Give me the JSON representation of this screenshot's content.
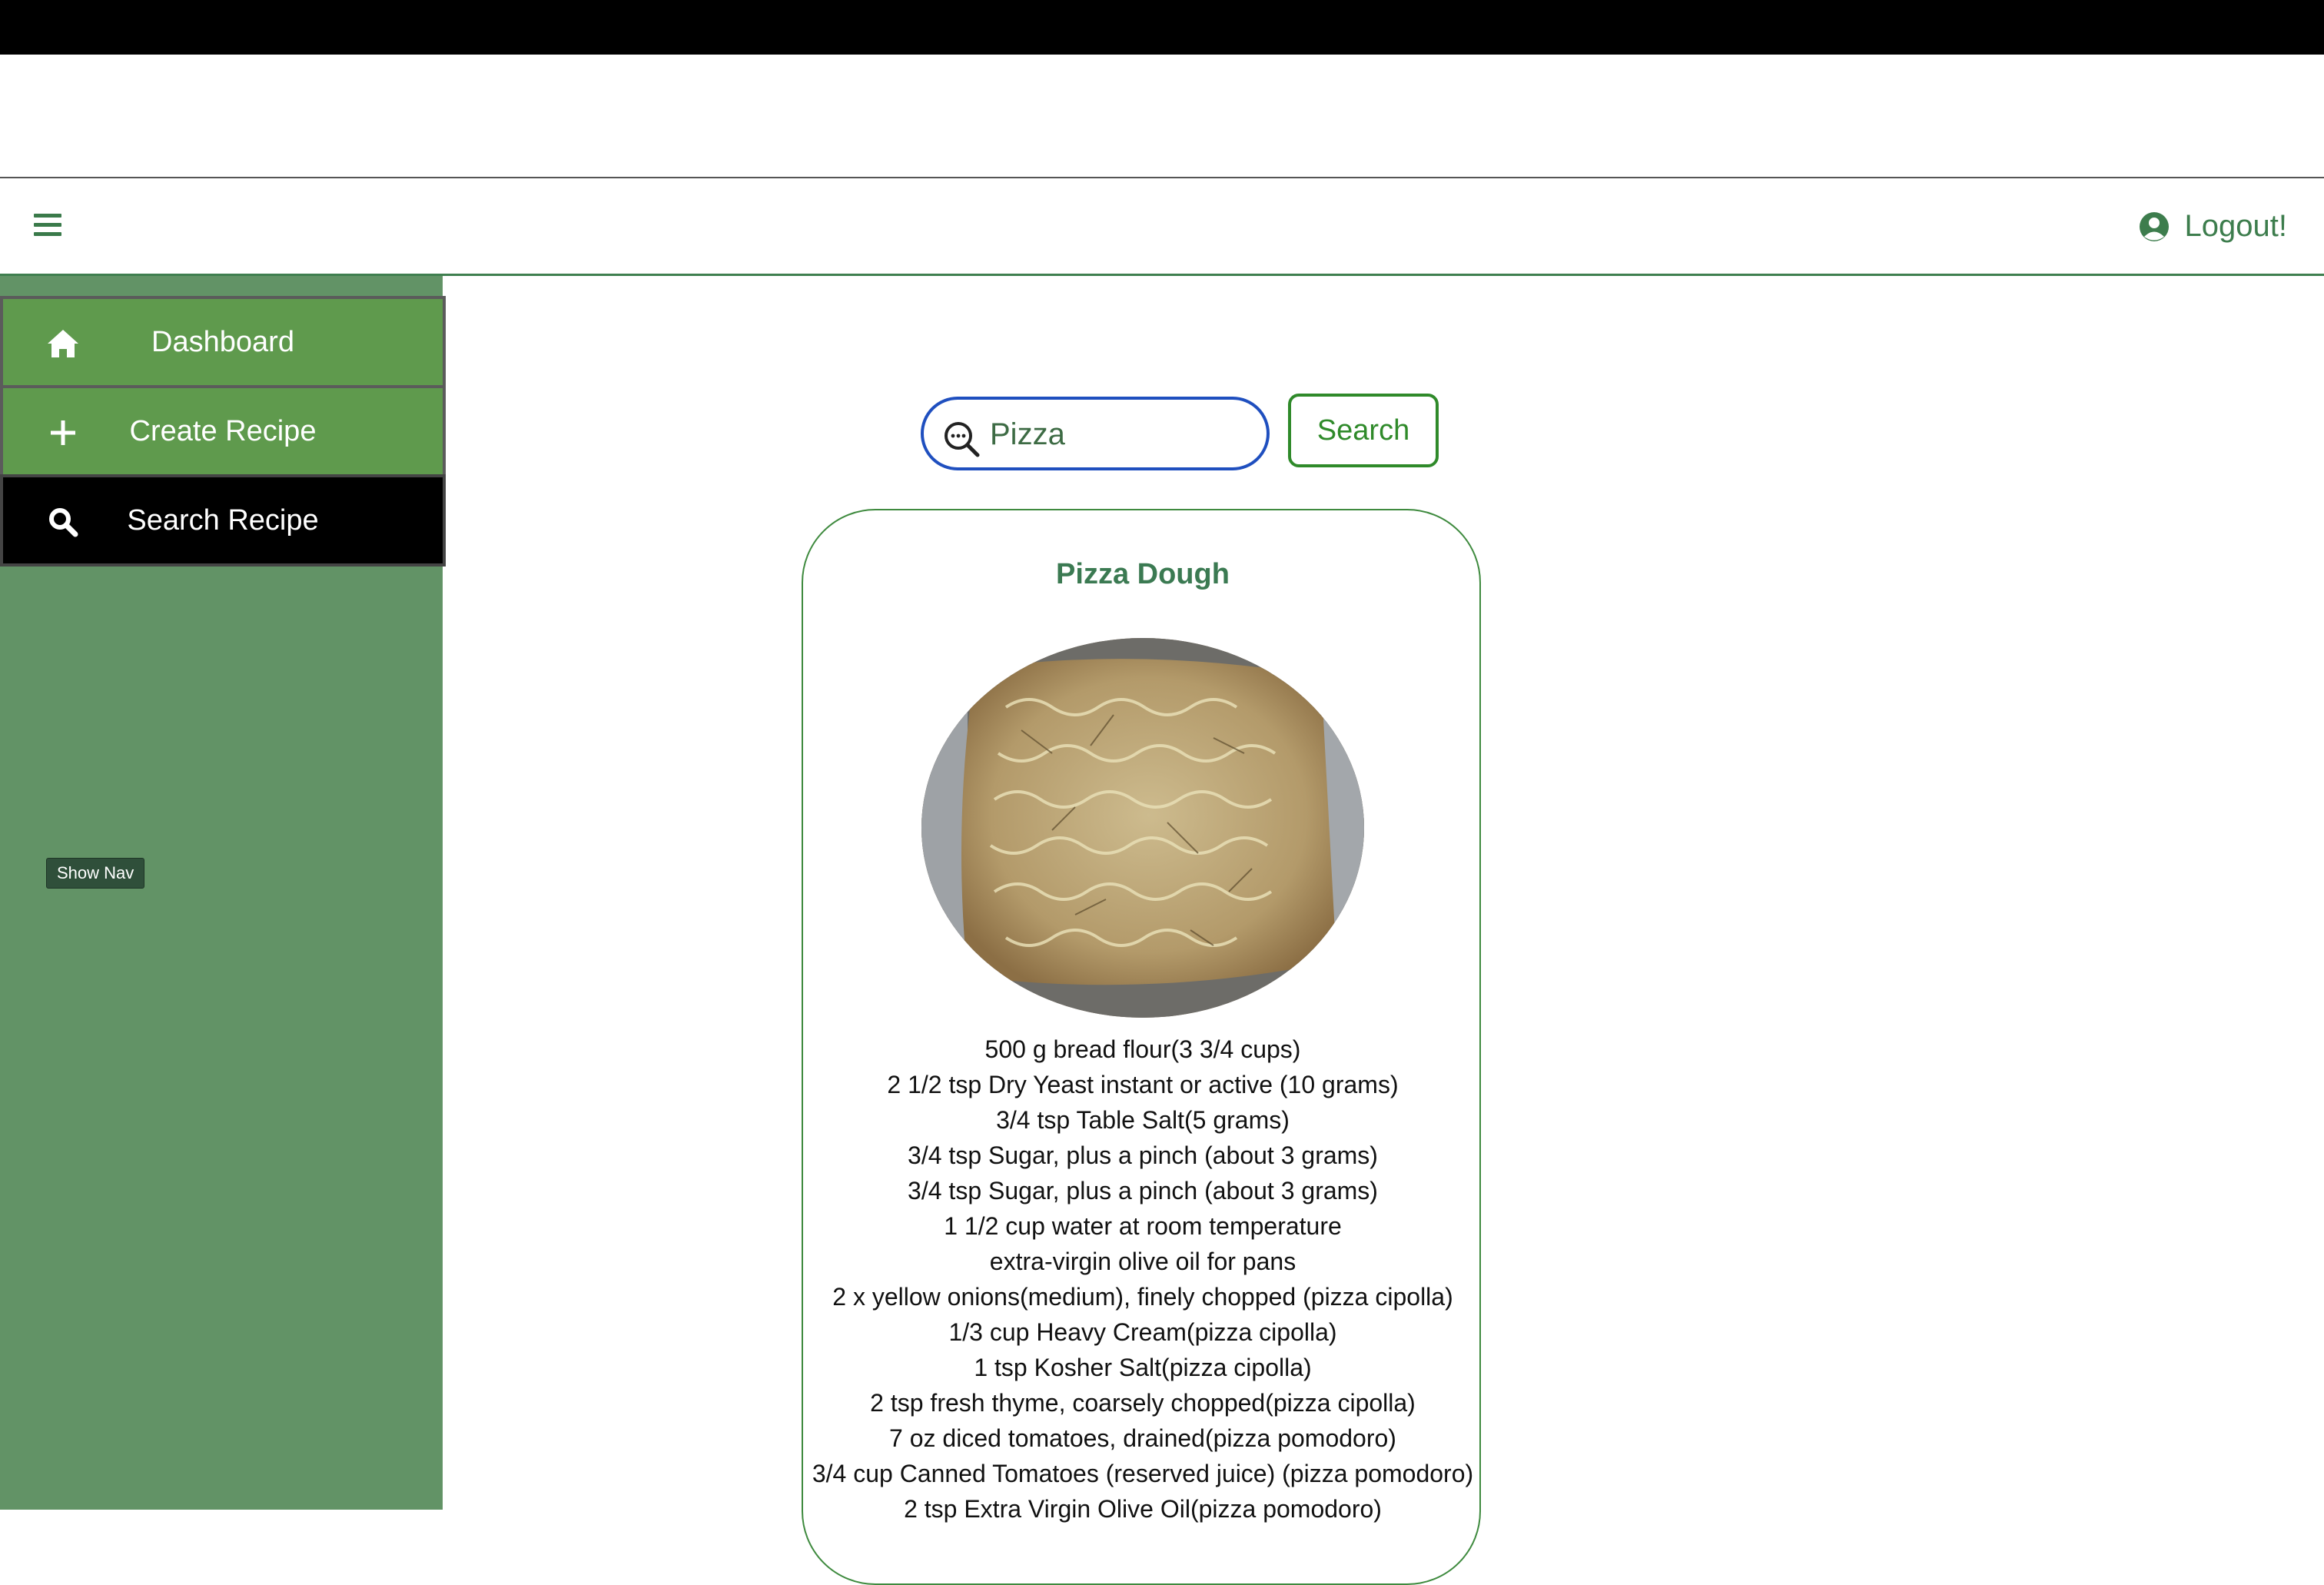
{
  "header": {
    "menu_icon": "hamburger-icon",
    "logout_icon": "user-circle-icon",
    "logout_label": "Logout!"
  },
  "sidebar": {
    "items": [
      {
        "label": "Dashboard",
        "icon": "home-icon"
      },
      {
        "label": "Create Recipe",
        "icon": "plus-icon"
      },
      {
        "label": "Search Recipe",
        "icon": "search-icon"
      }
    ],
    "show_nav_label": "Show Nav"
  },
  "search": {
    "value": "Pizza",
    "button_label": "Search",
    "icon": "zoom-search-icon"
  },
  "recipe": {
    "title": "Pizza Dough",
    "ingredients": [
      "500 g bread flour(3 3/4 cups)",
      "2 1/2 tsp Dry Yeast instant or active (10 grams)",
      "3/4 tsp Table Salt(5 grams)",
      "3/4 tsp Sugar, plus a pinch (about 3 grams)",
      "3/4 tsp Sugar, plus a pinch (about 3 grams)",
      "1 1/2 cup water at room temperature",
      "extra-virgin olive oil for pans",
      "2 x yellow onions(medium), finely chopped (pizza cipolla)",
      "1/3 cup Heavy Cream(pizza cipolla)",
      "1 tsp Kosher Salt(pizza cipolla)",
      "2 tsp fresh thyme, coarsely chopped(pizza cipolla)",
      "7 oz diced tomatoes, drained(pizza pomodoro)",
      "3/4 cup Canned Tomatoes (reserved juice) (pizza pomodoro)",
      "2 tsp Extra Virgin Olive Oil(pizza pomodoro)"
    ]
  },
  "colors": {
    "sidebar_bg": "#629366",
    "nav_active_bg": "#000000",
    "nav_item_bg": "#5f9a4d",
    "accent_green": "#3d7d4d",
    "search_border": "#1f4fbf"
  }
}
